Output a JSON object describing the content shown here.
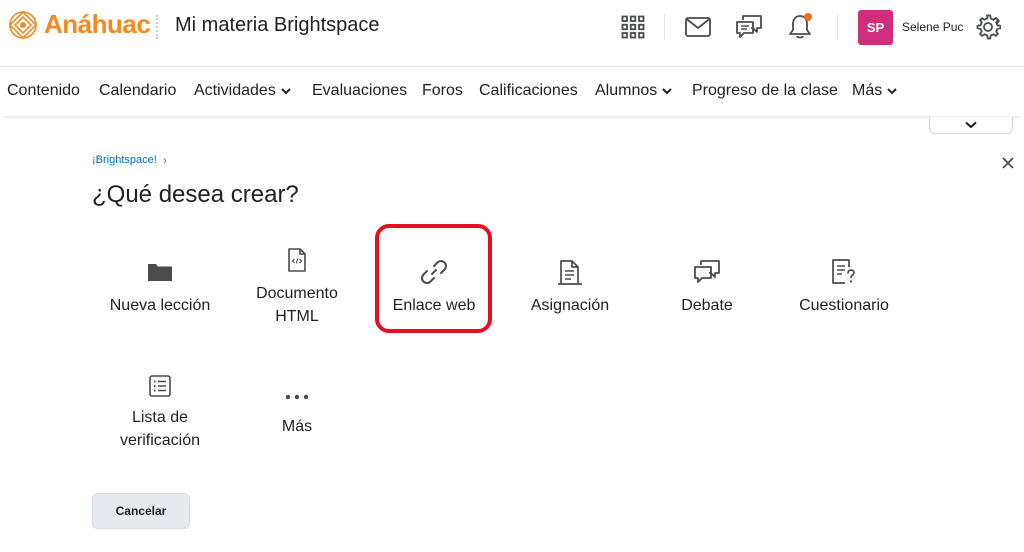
{
  "header": {
    "brand": "Anáhuac",
    "course_title": "Mi materia Brightspace",
    "user": {
      "initials": "SP",
      "name": "Selene Puc"
    },
    "icons": [
      "grid-icon",
      "mail-icon",
      "chat-icon",
      "bell-icon",
      "gear-icon"
    ],
    "notification_dot_color": "#ee6c1b",
    "avatar_color": "#cf2e7b",
    "brand_color": "#f08a24"
  },
  "nav": {
    "items": [
      {
        "label": "Contenido",
        "dropdown": false
      },
      {
        "label": "Calendario",
        "dropdown": false
      },
      {
        "label": "Actividades",
        "dropdown": true
      },
      {
        "label": "Evaluaciones",
        "dropdown": false
      },
      {
        "label": "Foros",
        "dropdown": false
      },
      {
        "label": "Calificaciones",
        "dropdown": false
      },
      {
        "label": "Alumnos",
        "dropdown": true
      },
      {
        "label": "Progreso de la clase",
        "dropdown": false
      },
      {
        "label": "Más",
        "dropdown": true
      }
    ]
  },
  "dialog": {
    "breadcrumb": "¡Brightspace!",
    "title": "¿Qué desea crear?",
    "options": [
      {
        "label": "Nueva lección",
        "icon": "folder-icon"
      },
      {
        "label": "Documento HTML",
        "icon": "html-document-icon"
      },
      {
        "label": "Enlace web",
        "icon": "link-icon",
        "highlighted": true
      },
      {
        "label": "Asignación",
        "icon": "assignment-icon"
      },
      {
        "label": "Debate",
        "icon": "discussion-icon"
      },
      {
        "label": "Cuestionario",
        "icon": "quiz-icon"
      },
      {
        "label": "Lista de verificación",
        "icon": "checklist-icon"
      },
      {
        "label": "Más",
        "icon": "more-icon"
      }
    ],
    "cancel_label": "Cancelar",
    "highlight_color": "#e3101f",
    "link_color": "#006fbf"
  }
}
